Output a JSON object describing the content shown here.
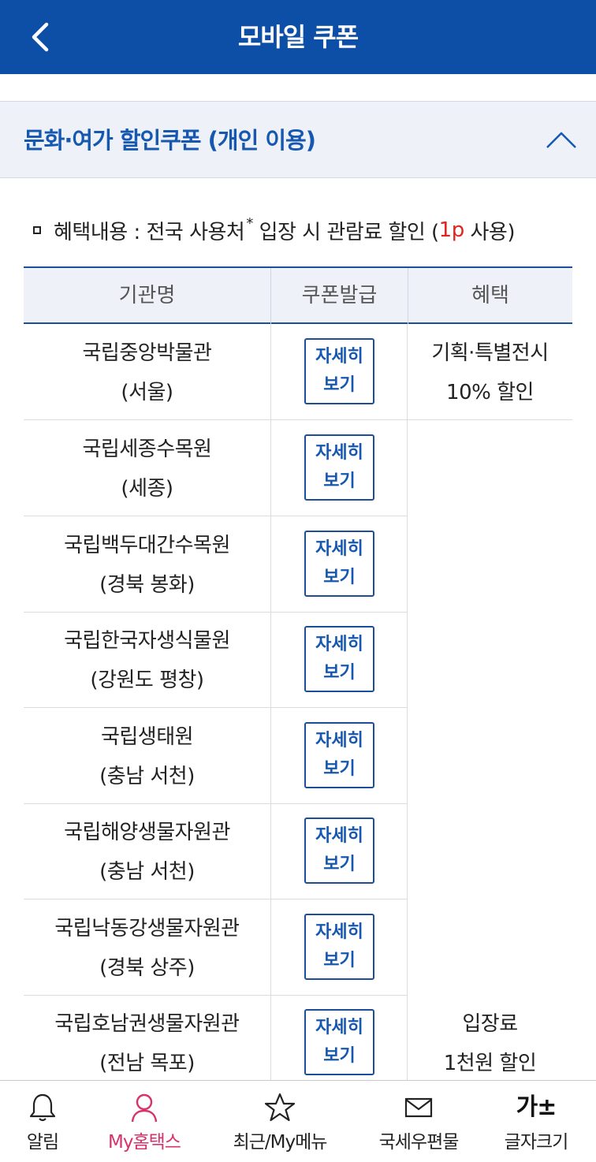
{
  "header": {
    "title": "모바일 쿠폰",
    "back_icon": "chevron-left-icon"
  },
  "section": {
    "title": "문화·여가 할인쿠폰 (개인 이용)",
    "toggle_icon": "chevron-up-icon"
  },
  "benefit_line": {
    "prefix": "혜택내용 : 전국 사용처",
    "asterisk": "*",
    "middle": " 입장 시 관람료 할인 (",
    "points": "1p",
    "suffix": " 사용)"
  },
  "table": {
    "headers": [
      "기관명",
      "쿠폰발급",
      "혜택"
    ],
    "rows": [
      {
        "name": "국립중앙박물관",
        "location": "(서울)",
        "btn_line1": "자세히",
        "btn_line2": "보기"
      },
      {
        "name": "국립세종수목원",
        "location": "(세종)",
        "btn_line1": "자세히",
        "btn_line2": "보기"
      },
      {
        "name": "국립백두대간수목원",
        "location": "(경북 봉화)",
        "btn_line1": "자세히",
        "btn_line2": "보기"
      },
      {
        "name": "국립한국자생식물원",
        "location": "(강원도 평창)",
        "btn_line1": "자세히",
        "btn_line2": "보기"
      },
      {
        "name": "국립생태원",
        "location": "(충남 서천)",
        "btn_line1": "자세히",
        "btn_line2": "보기"
      },
      {
        "name": "국립해양생물자원관",
        "location": "(충남 서천)",
        "btn_line1": "자세히",
        "btn_line2": "보기"
      },
      {
        "name": "국립낙동강생물자원관",
        "location": "(경북 상주)",
        "btn_line1": "자세히",
        "btn_line2": "보기"
      },
      {
        "name": "국립호남권생물자원관",
        "location": "(전남 목포)",
        "btn_line1": "자세히",
        "btn_line2": "보기"
      }
    ],
    "benefit_a": {
      "line1": "기획·특별전시",
      "line2": "10% 할인"
    },
    "benefit_b": {
      "line1": "입장료",
      "line2": "1천원 할인"
    }
  },
  "tabbar": {
    "tabs": [
      {
        "label": "알림",
        "icon": "bell-icon"
      },
      {
        "label": "My홈택스",
        "icon": "user-icon"
      },
      {
        "label": "최근/My메뉴",
        "icon": "star-icon"
      },
      {
        "label": "국세우편물",
        "icon": "mail-icon"
      },
      {
        "label": "글자크기",
        "icon": "font-size-icon",
        "glyph": "가±"
      }
    ],
    "active_color": "#d6336c"
  },
  "colors": {
    "header_bg": "#0d4ea6",
    "accent": "#1657b0",
    "section_bg": "#eef2f8",
    "points": "#e0231b"
  }
}
